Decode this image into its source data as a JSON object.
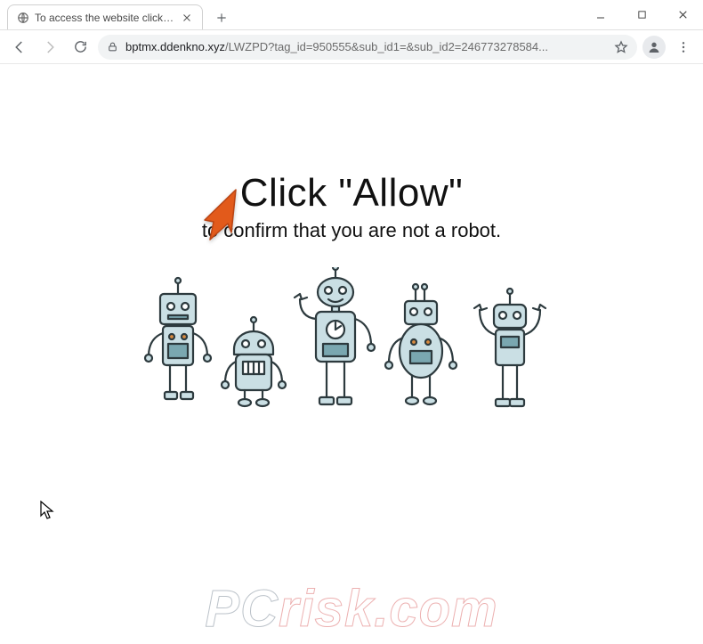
{
  "window": {
    "tab_title": "To access the website click the \"A",
    "new_tab_label": "+"
  },
  "toolbar": {
    "url_domain": "bptmx.ddenkno.xyz",
    "url_path": "/LWZPD?tag_id=950555&sub_id1=&sub_id2=246773278584..."
  },
  "page": {
    "headline": "Click \"Allow\"",
    "subtext": "to confirm that you are not a robot."
  },
  "watermark": {
    "left": "PC",
    "right": "risk.com"
  },
  "icons": {
    "globe": "globe-icon",
    "close": "close-icon",
    "plus": "plus-icon",
    "minimize": "minimize-icon",
    "maximize": "maximize-icon",
    "win_close": "window-close-icon",
    "back": "back-icon",
    "forward": "forward-icon",
    "reload": "reload-icon",
    "lock": "lock-icon",
    "star": "star-icon",
    "profile": "profile-icon",
    "menu": "menu-icon",
    "pointer_arrow": "pointer-arrow-annotation",
    "mouse_cursor": "mouse-cursor"
  },
  "colors": {
    "arrow": "#e25a1b",
    "robot_body": "#cadfe4",
    "robot_accent": "#7aa7b0",
    "robot_outline": "#2d3a3e",
    "robot_orange": "#d98a3e",
    "omnibox_bg": "#f1f3f4"
  }
}
